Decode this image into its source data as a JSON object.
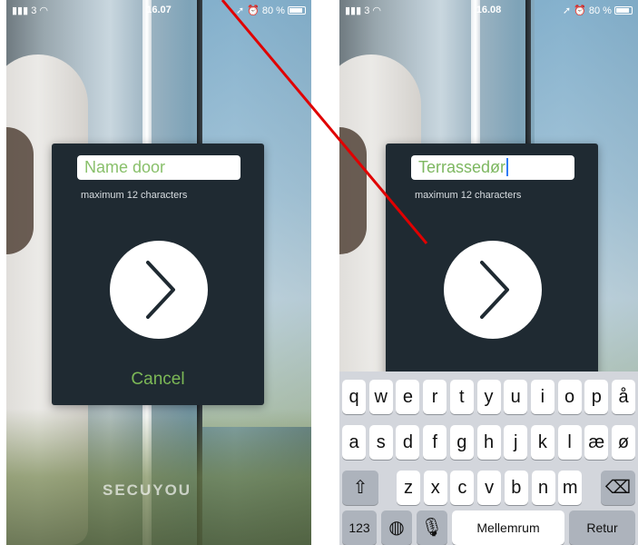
{
  "left_screen": {
    "status": {
      "signal": "3",
      "time": "16.07",
      "battery": "80 %"
    },
    "name_field": {
      "placeholder": "Name door",
      "value": ""
    },
    "hint": "maximum 12 characters",
    "cancel_label": "Cancel",
    "logo_text": "SECUYOU"
  },
  "right_screen": {
    "status": {
      "signal": "3",
      "time": "16.08",
      "battery": "80 %"
    },
    "name_field": {
      "value": "Terrassedør"
    },
    "hint": "maximum 12 characters",
    "keyboard": {
      "row1": [
        "q",
        "w",
        "e",
        "r",
        "t",
        "y",
        "u",
        "i",
        "o",
        "p",
        "å"
      ],
      "row2": [
        "a",
        "s",
        "d",
        "f",
        "g",
        "h",
        "j",
        "k",
        "l",
        "æ",
        "ø"
      ],
      "row3": [
        "z",
        "x",
        "c",
        "v",
        "b",
        "n",
        "m"
      ],
      "numbers_label": "123",
      "space_label": "Mellemrum",
      "return_label": "Retur"
    }
  },
  "colors": {
    "accent_green": "#7cb856",
    "dialog_bg": "#1f2a32",
    "annotation_red": "#e00000"
  },
  "icons": [
    "chevron-right-icon",
    "wifi-icon",
    "location-icon",
    "alarm-icon",
    "battery-icon",
    "shift-icon",
    "globe-icon",
    "microphone-icon",
    "backspace-icon"
  ]
}
